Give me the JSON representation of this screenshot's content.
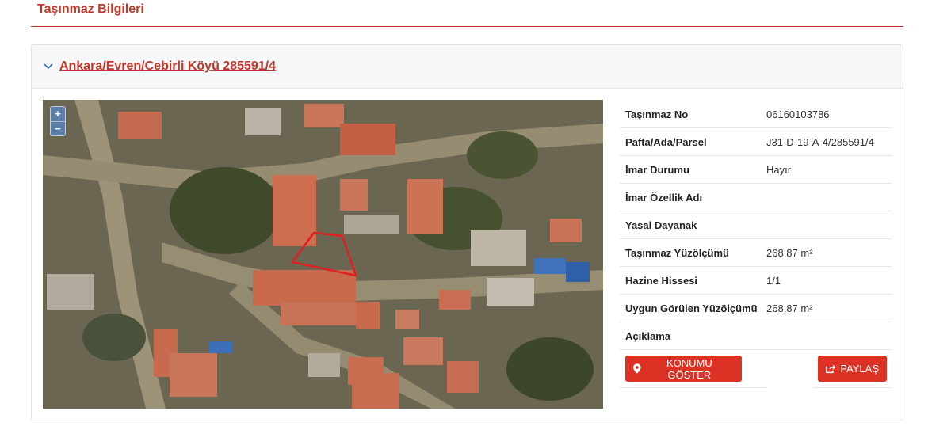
{
  "section": {
    "title": "Taşınmaz Bilgileri"
  },
  "card": {
    "header_link": "Ankara/Evren/Cebirli Köyü 285591/4",
    "chevron_icon": "chevron-down-icon"
  },
  "map": {
    "zoom_in": "+",
    "zoom_out": "−",
    "parcel_color": "#e02020"
  },
  "info": {
    "rows": [
      {
        "label": "Taşınmaz No",
        "value": "06160103786"
      },
      {
        "label": "Pafta/Ada/Parsel",
        "value": "J31-D-19-A-4/285591/4"
      },
      {
        "label": "İmar Durumu",
        "value": "Hayır"
      },
      {
        "label": "İmar Özellik Adı",
        "value": ""
      },
      {
        "label": "Yasal Dayanak",
        "value": ""
      },
      {
        "label": "Taşınmaz Yüzölçümü",
        "value": "268,87 m²"
      },
      {
        "label": "Hazine Hissesi",
        "value": "1/1"
      },
      {
        "label": "Uygun Görülen Yüzölçümü",
        "value": "268,87 m²"
      },
      {
        "label": "Açıklama",
        "value": ""
      }
    ]
  },
  "actions": {
    "show_location": "KONUMU GÖSTER",
    "share": "PAYLAŞ"
  },
  "colors": {
    "accent": "#c0392b",
    "button": "#dc3125"
  }
}
